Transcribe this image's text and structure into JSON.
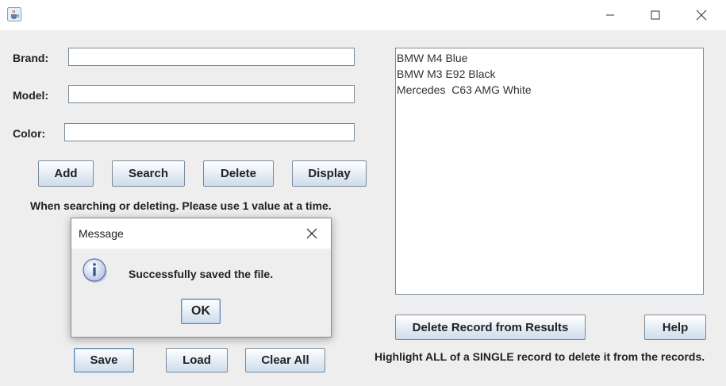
{
  "window": {
    "title": "",
    "icon": "java-cup-icon"
  },
  "form": {
    "brand_label": "Brand:",
    "model_label": "Model:",
    "color_label": "Color:",
    "brand_value": "",
    "model_value": "",
    "color_value": ""
  },
  "buttons": {
    "add": "Add",
    "search": "Search",
    "delete": "Delete",
    "display": "Display",
    "save": "Save",
    "load": "Load",
    "clear_all": "Clear All",
    "delete_record": "Delete Record from Results",
    "help": "Help"
  },
  "hints": {
    "search_delete": "When searching or deleting.  Please use 1 value at a time.",
    "highlight": "Highlight ALL of a SINGLE record to delete it from the records."
  },
  "results": {
    "items": [
      "BMW M4 Blue",
      "BMW M3 E92 Black",
      "Mercedes  C63 AMG White"
    ]
  },
  "dialog": {
    "title": "Message",
    "message": "Successfully saved the file.",
    "ok_label": "OK",
    "icon": "information-icon"
  },
  "colors": {
    "background": "#eeeeee",
    "button_border": "#7a8a99",
    "focus_border": "#6382be"
  }
}
